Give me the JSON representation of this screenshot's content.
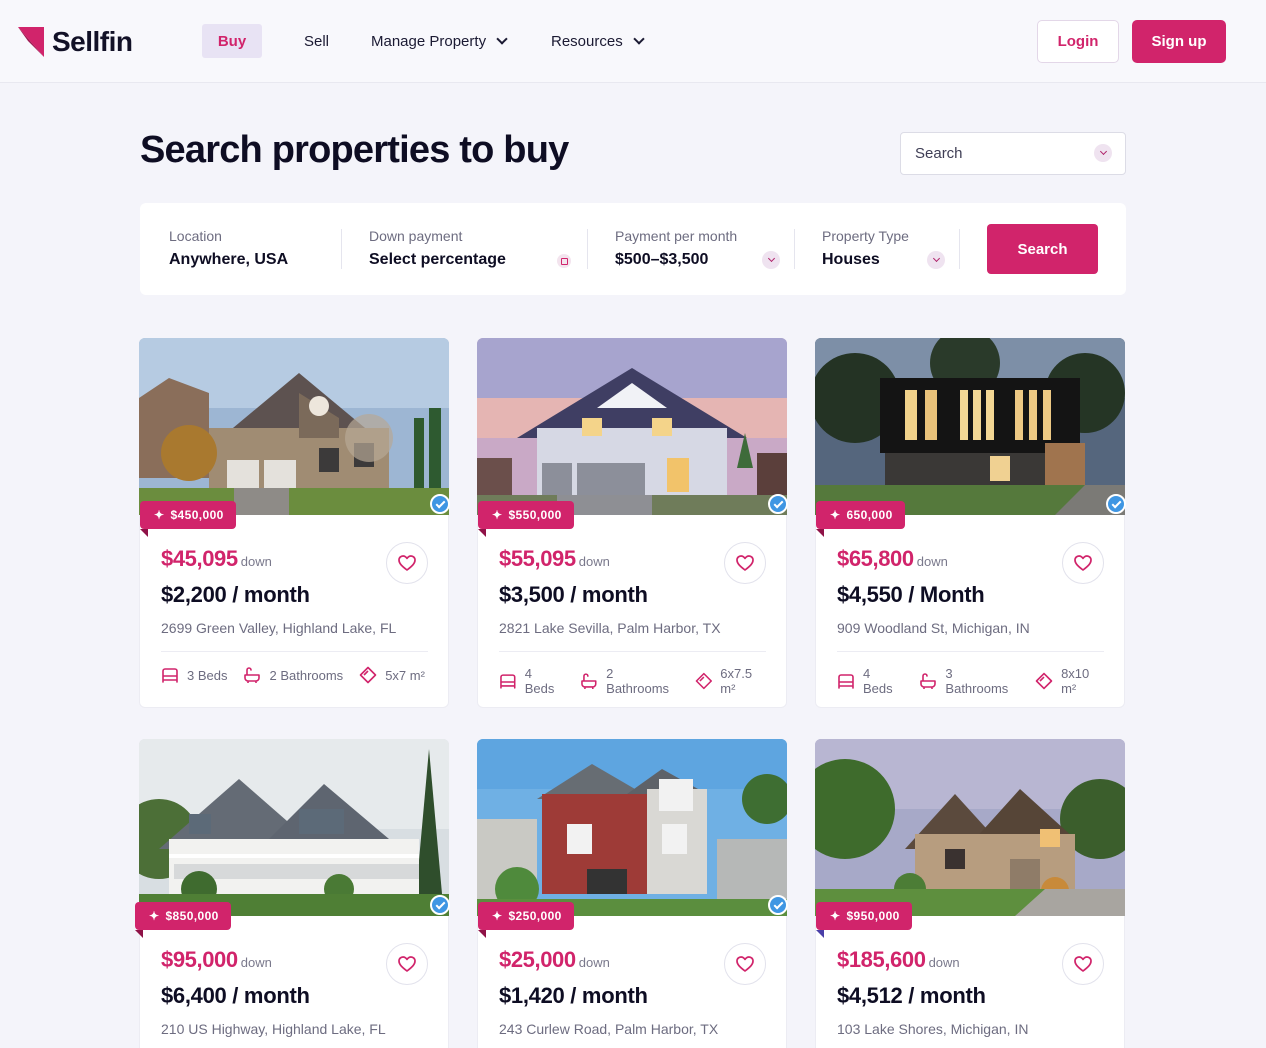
{
  "brand": {
    "name": "Sellfin",
    "accent": "#D1246B"
  },
  "nav": {
    "buy": "Buy",
    "sell": "Sell",
    "manage_property": "Manage Property",
    "resources": "Resources",
    "login": "Login",
    "signup": "Sign up"
  },
  "page": {
    "title": "Search properties to buy",
    "search_select": "Search"
  },
  "filters": {
    "location": {
      "label": "Location",
      "value": "Anywhere, USA"
    },
    "down_payment": {
      "label": "Down payment",
      "value": "Select percentage"
    },
    "payment_per_month": {
      "label": "Payment per month",
      "value": "$500–$3,500"
    },
    "property_type": {
      "label": "Property Type",
      "value": "Houses"
    },
    "search_button": "Search"
  },
  "listings": [
    {
      "badge": "$450,000",
      "down": "$45,095",
      "down_word": "down",
      "monthly": "$2,200 / month",
      "address": "2699 Green Valley, Highland Lake, FL",
      "beds": "3 Beds",
      "baths": "2 Bathrooms",
      "area": "5x7 m²",
      "verified": true
    },
    {
      "badge": "$550,000",
      "down": "$55,095",
      "down_word": "down",
      "monthly": "$3,500 / month",
      "address": "2821 Lake Sevilla, Palm Harbor, TX",
      "beds": "4 Beds",
      "baths": "2 Bathrooms",
      "area": "6x7.5 m²",
      "verified": true
    },
    {
      "badge": "650,000",
      "down": "$65,800",
      "down_word": "down",
      "monthly": "$4,550 / Month",
      "address": "909 Woodland St, Michigan, IN",
      "beds": "4 Beds",
      "baths": "3 Bathrooms",
      "area": "8x10 m²",
      "verified": true
    },
    {
      "badge": "$850,000",
      "down": "$95,000",
      "down_word": "down",
      "monthly": "$6,400 / month",
      "address": "210 US Highway, Highland Lake, FL",
      "verified": true
    },
    {
      "badge": "$250,000",
      "down": "$25,000",
      "down_word": "down",
      "monthly": "$1,420 / month",
      "address": "243 Curlew Road, Palm Harbor, TX",
      "verified": true
    },
    {
      "badge": "$950,000",
      "down": "$185,600",
      "down_word": "down",
      "monthly": "$4,512 / month",
      "address": "103 Lake Shores, Michigan, IN",
      "verified": false
    }
  ]
}
